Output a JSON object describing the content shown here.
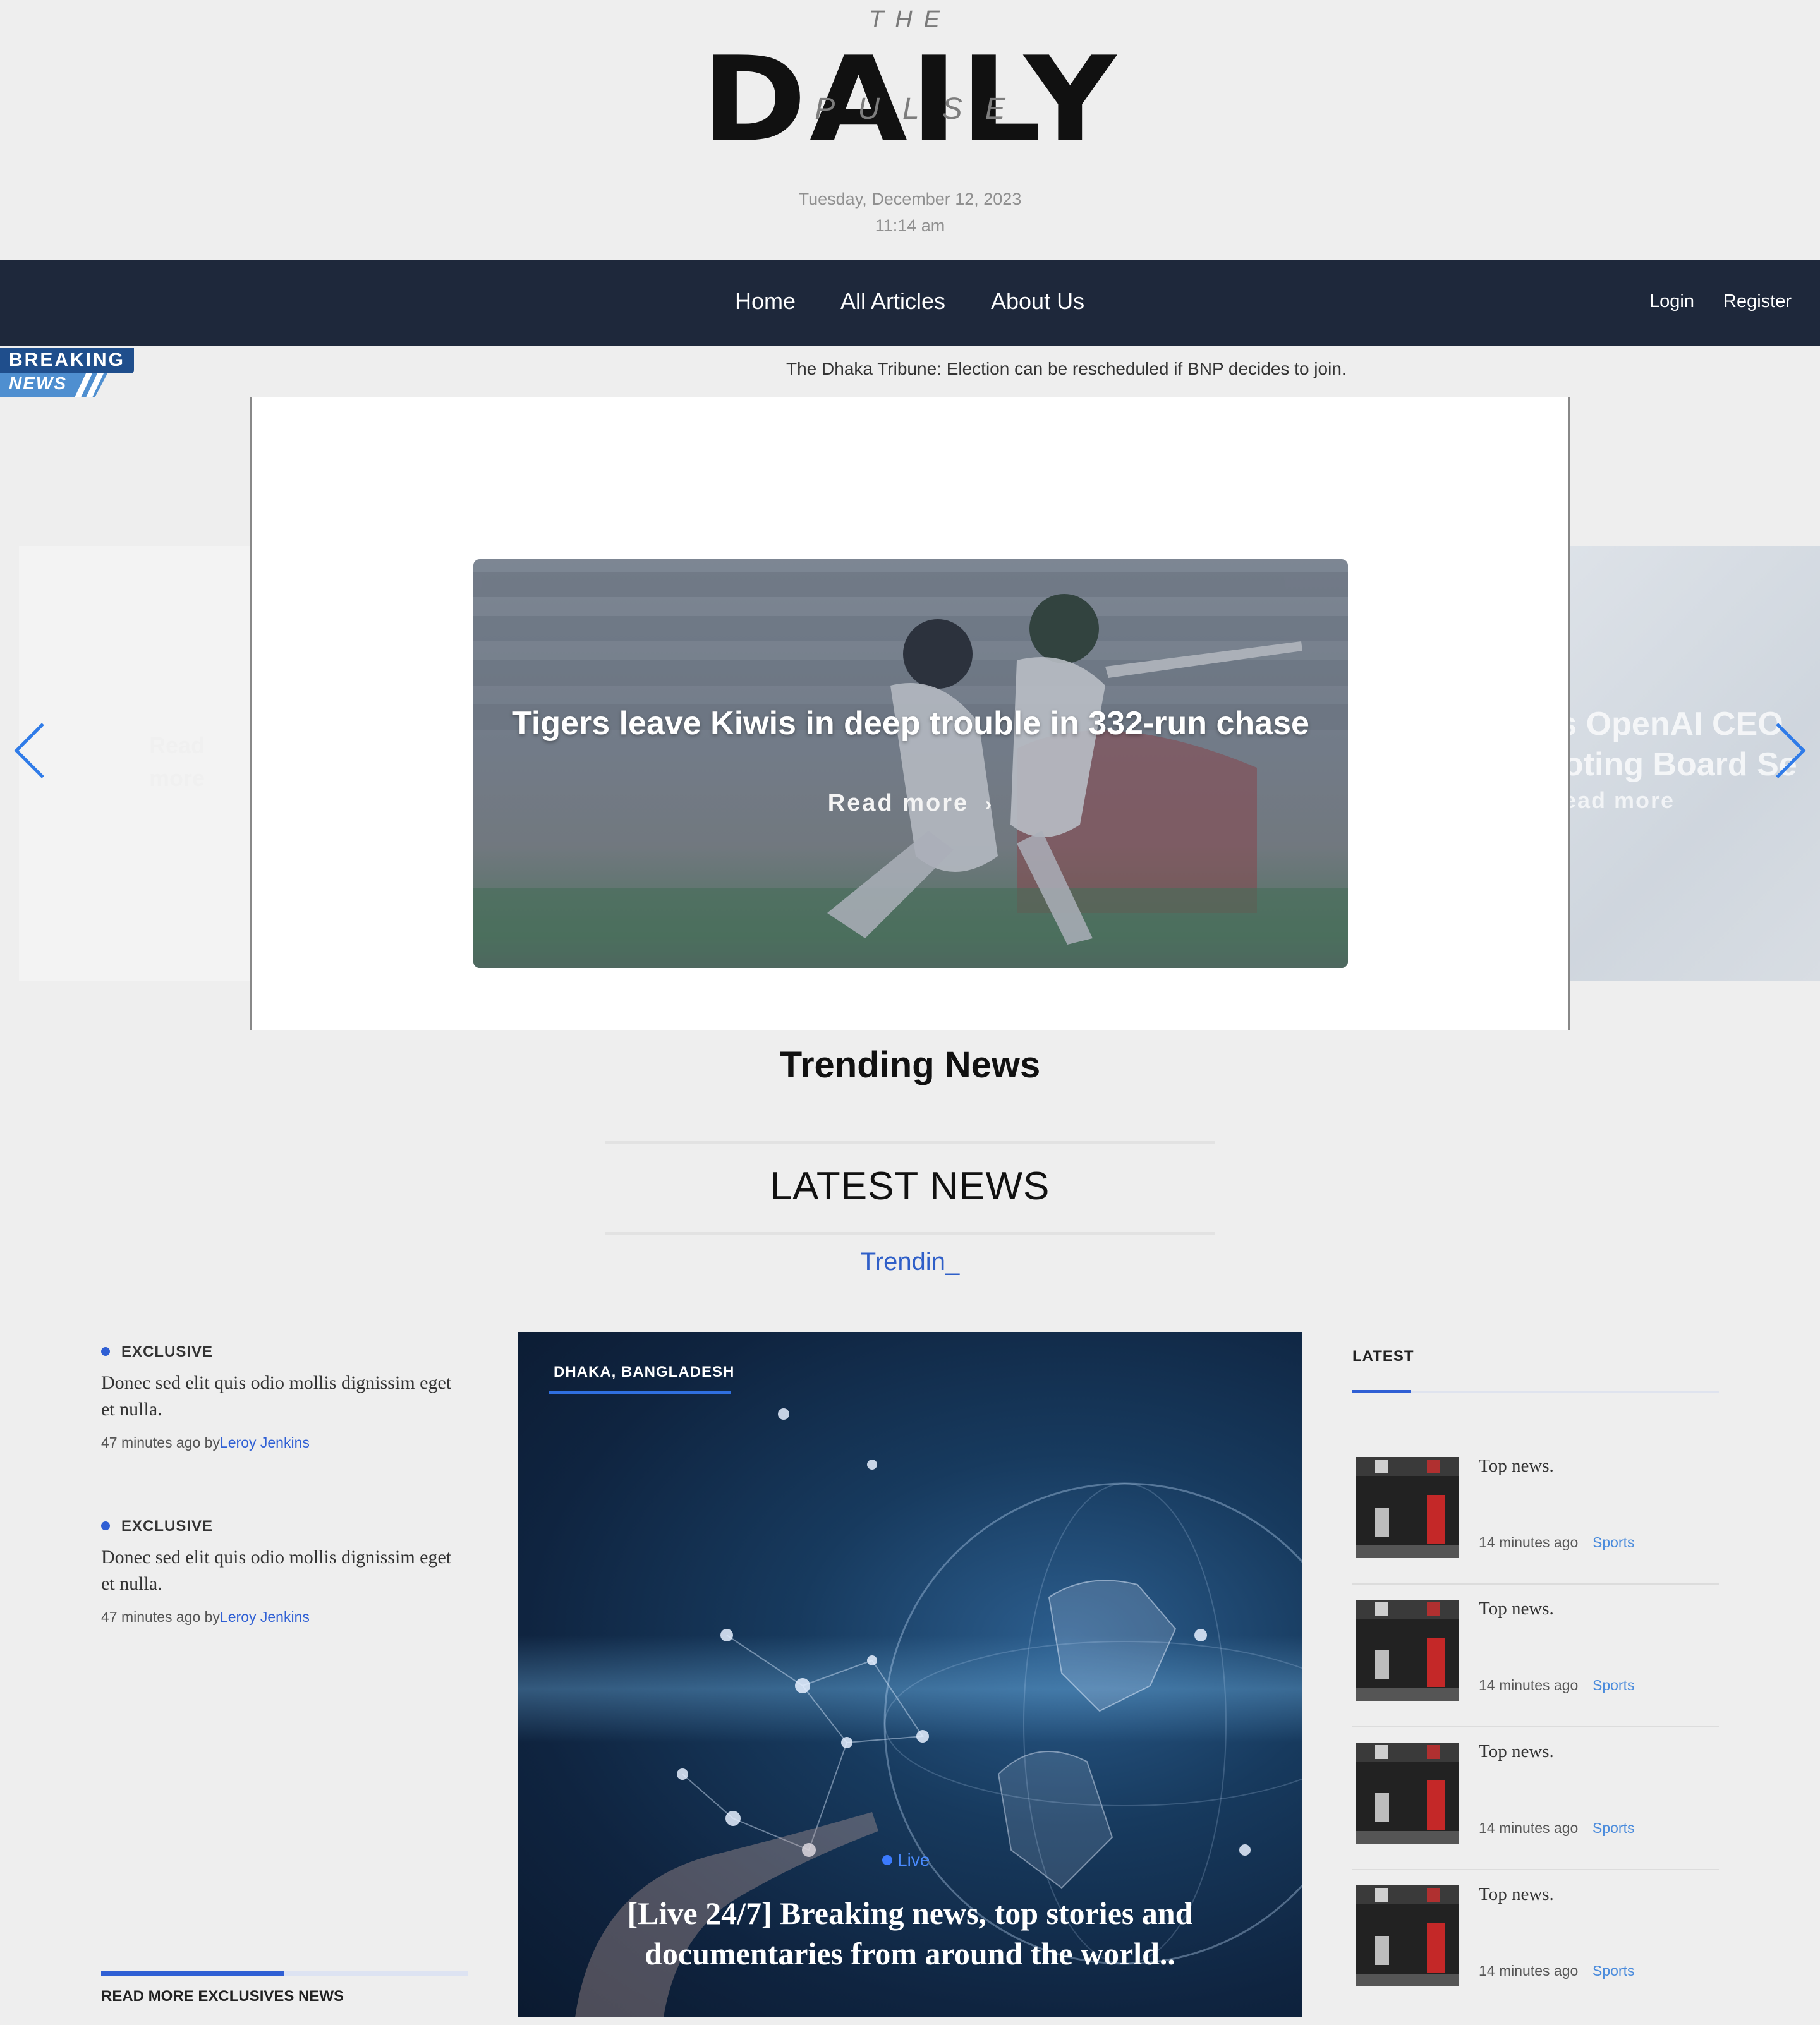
{
  "header": {
    "logo_the": "THE",
    "logo_daily": "DAILY",
    "logo_pulse": "PULSE",
    "date": "Tuesday, December 12, 2023",
    "time": "11:14 am"
  },
  "nav": {
    "links": [
      "Home",
      "All Articles",
      "About Us"
    ],
    "login": "Login",
    "register": "Register"
  },
  "breaking": {
    "badge_top": "BREAKING",
    "badge_bottom": "NEWS",
    "ticker": "The Dhaka Tribune: Election can be rescheduled if BNP decides to join."
  },
  "carousel": {
    "prev_read": "Read more",
    "active_title": "Tigers leave Kiwis in deep trouble in 332-run chase",
    "active_read": "Read more",
    "next_title_line1": "s as OpenAI CEO",
    "next_title_line2": "n-Voting Board Se",
    "next_read": "ead more",
    "prev_icon": "chevron-left-icon",
    "next_icon": "chevron-right-icon"
  },
  "sections": {
    "trending": "Trending News",
    "latest_news": "LATEST NEWS",
    "trendin": "Trendin_"
  },
  "exclusives": {
    "items": [
      {
        "label": "EXCLUSIVE",
        "text": "Donec sed elit quis odio mollis dignissim eget et nulla.",
        "time": "47 minutes ago by",
        "author": "Leroy Jenkins"
      },
      {
        "label": "EXCLUSIVE",
        "text": "Donec sed elit quis odio mollis dignissim eget et nulla.",
        "time": "47 minutes ago by",
        "author": "Leroy Jenkins"
      }
    ],
    "read_more": "READ MORE EXCLUSIVES NEWS",
    "read_more_progress": 0.5
  },
  "feature": {
    "location": "DHAKA, BANGLADESH",
    "live": "Live",
    "title": "[Live 24/7] Breaking news, top stories and documentaries from around the world.."
  },
  "latest": {
    "label": "LATEST",
    "items": [
      {
        "title": "Top news.",
        "time": "14 minutes ago",
        "category": "Sports"
      },
      {
        "title": "Top news.",
        "time": "14 minutes ago",
        "category": "Sports"
      },
      {
        "title": "Top news.",
        "time": "14 minutes ago",
        "category": "Sports"
      },
      {
        "title": "Top news.",
        "time": "14 minutes ago",
        "category": "Sports"
      }
    ]
  },
  "colors": {
    "nav_bg": "#1e283b",
    "accent": "#2f5fd4",
    "page_bg": "#eeeeee"
  }
}
